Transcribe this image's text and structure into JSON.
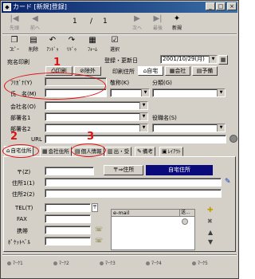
{
  "window": {
    "title": "カード [新規]登録]",
    "min": "_",
    "max": "□",
    "close": "×"
  },
  "toolbar": {
    "nav_first": "先頭",
    "nav_prev": "前へ",
    "page_current": "1",
    "page_sep": "/",
    "page_total": "1",
    "nav_next": "次へ",
    "nav_last": "最後",
    "new_label": "新規",
    "row2": {
      "copy": "ｺﾋﾟｰ",
      "delete": "削除",
      "undo": "ｱﾝﾄﾞｩ",
      "redo": "ﾘﾄﾞｩ",
      "form": "ﾌｫｰﾑ",
      "select": "選択"
    }
  },
  "header": {
    "atena_label": "宛名印刷",
    "print_label": "印刷",
    "exclude_label": "除外",
    "reg_label": "登録・更新日",
    "date_value": "2001/10/29(月)",
    "print_dest_label": "印刷住所",
    "home_btn": "自宅",
    "company_btn": "会社",
    "backup_btn": "予備"
  },
  "form": {
    "furigana_label": "ﾌﾘｶﾞﾅ(Y)",
    "name_label": "氏　名(M)",
    "honorific_label": "敬称(K)",
    "category_label": "分類(G)",
    "company_label": "会社名(O)",
    "dept1_label": "部署名1",
    "dept2_label": "部署名2",
    "position_label": "役職名(S)",
    "url_label": "URL"
  },
  "tabs": [
    {
      "icon": "⌂",
      "label": "自宅住所"
    },
    {
      "icon": "▦",
      "label": "会社住所"
    },
    {
      "icon": "▤",
      "label": "個人情報"
    },
    {
      "icon": "▥",
      "label": "出・受"
    },
    {
      "icon": "✎",
      "label": "備考"
    },
    {
      "icon": "▣",
      "label": "ﾚｲｱｳﾄ"
    }
  ],
  "address": {
    "zip_label": "〒(Z)",
    "zip_button": "〒⇒住所",
    "home_address_banner": "自宅住所",
    "addr1_label": "住所1(1)",
    "addr2_label": "住所2(2)",
    "tel_label": "TEL(T)",
    "fax_label": "FAX",
    "mobile_label": "携帯",
    "pager_label": "ﾎﾟｹｯﾄﾍﾞﾙ",
    "email_header": "e-mail",
    "email_col2": "送..."
  },
  "marks": [
    "ﾏｰｸ1",
    "ﾏｰｸ2",
    "ﾏｰｸ3",
    "ﾏｰｸ4",
    "ﾏｰｸ5"
  ],
  "annotations": [
    "1",
    "2",
    "3"
  ],
  "colors": {
    "title_bar": "#0a246a",
    "annotation_red": "#e01010",
    "banner_blue": "#0a0a7a"
  }
}
